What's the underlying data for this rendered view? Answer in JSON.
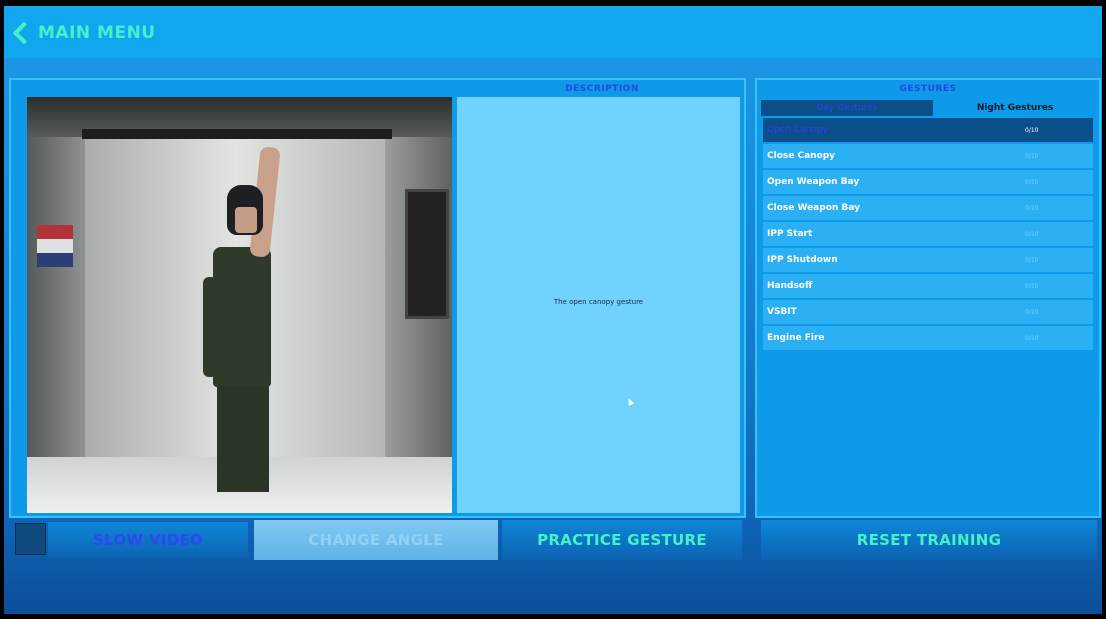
{
  "header": {
    "back_label": "MAIN MENU"
  },
  "description": {
    "title": "DESCRIPTION",
    "text": "The open canopy gesture"
  },
  "controls": {
    "slow_video": "SLOW VIDEO",
    "change_angle": "CHANGE ANGLE",
    "practice_gesture": "PRACTICE GESTURE",
    "reset_training": "RESET TRAINING"
  },
  "gestures": {
    "title": "GESTURES",
    "tabs": [
      {
        "label": "Day Gestures",
        "active": true
      },
      {
        "label": "Night Gestures",
        "active": false
      }
    ],
    "items": [
      {
        "name": "Open Canopy",
        "score": "0/10"
      },
      {
        "name": "Close Canopy",
        "score": "0/10"
      },
      {
        "name": "Open Weapon Bay",
        "score": "0/10"
      },
      {
        "name": "Close Weapon Bay",
        "score": "0/10"
      },
      {
        "name": "IPP Start",
        "score": "0/10"
      },
      {
        "name": "IPP Shutdown",
        "score": "0/10"
      },
      {
        "name": "Handsoff",
        "score": "0/10"
      },
      {
        "name": "VSBIT",
        "score": "0/10"
      },
      {
        "name": "Engine Fire",
        "score": "0/10"
      }
    ],
    "selected_index": 0
  },
  "colors": {
    "accent": "#46f0c8",
    "panel": "#0d9ae8",
    "label_blue": "#2b46e8"
  }
}
